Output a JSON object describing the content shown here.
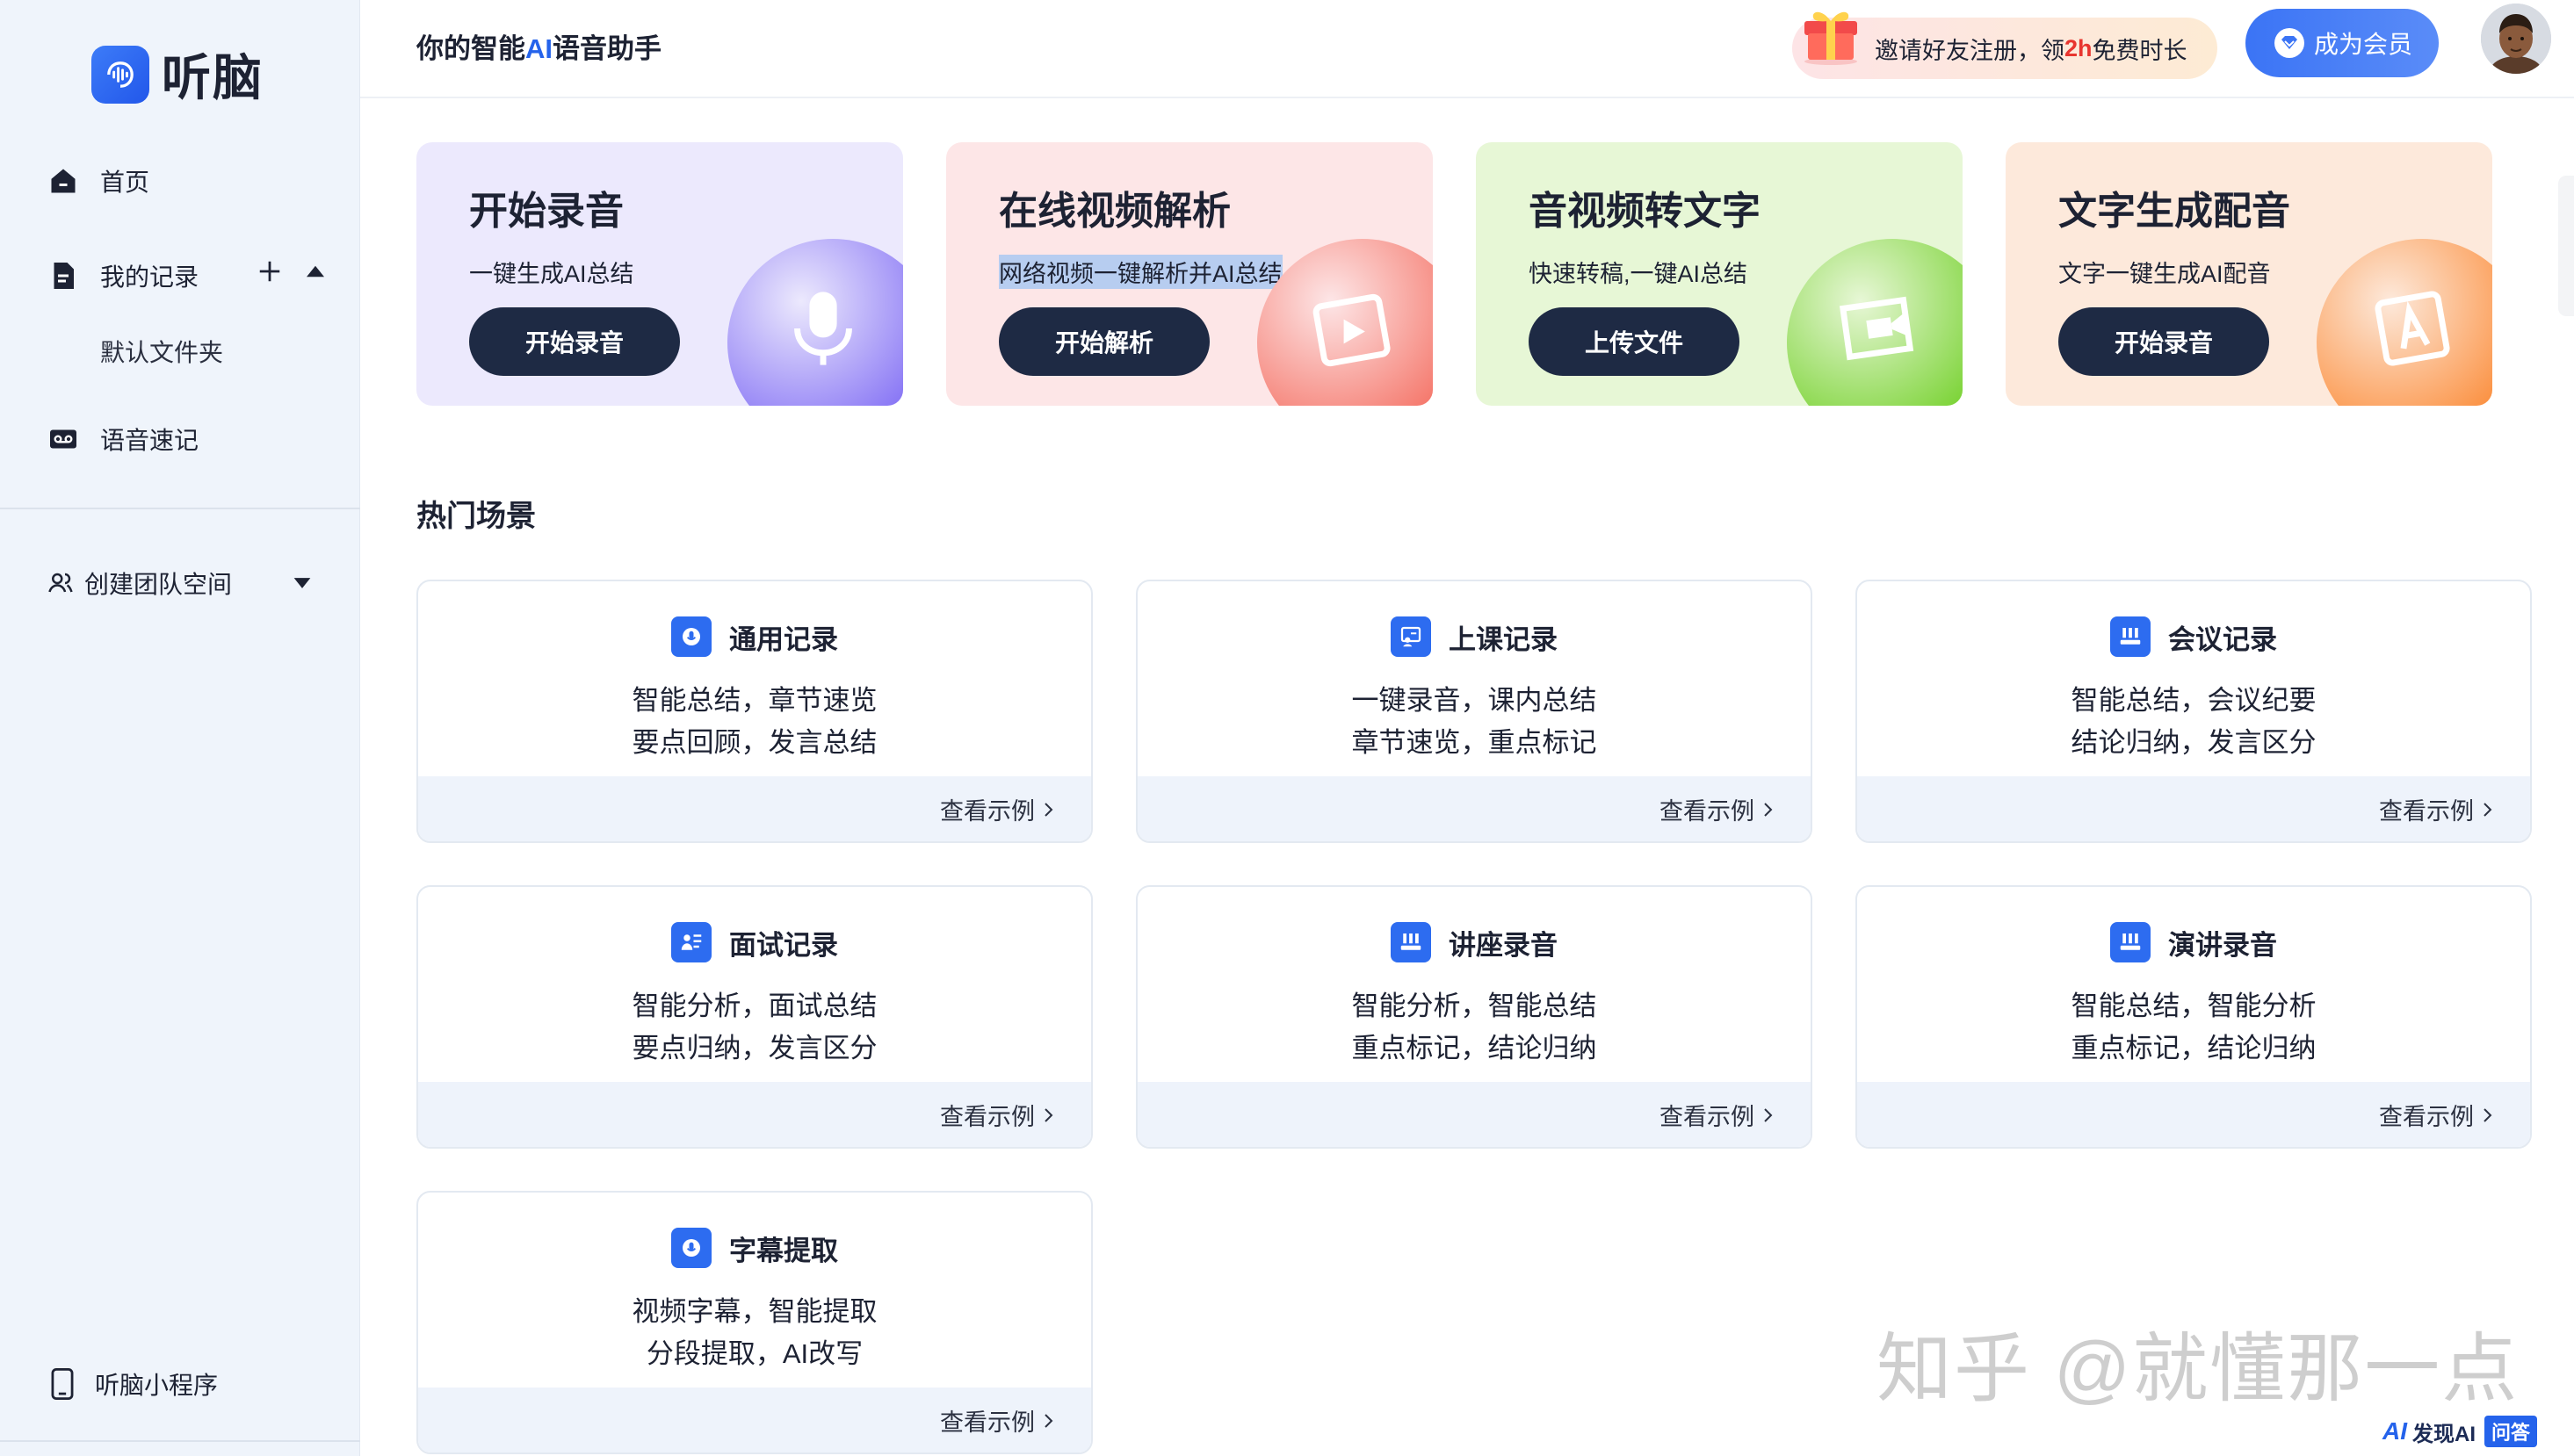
{
  "app": {
    "name": "听脑"
  },
  "sidebar": {
    "home": "首页",
    "records": "我的记录",
    "default_folder": "默认文件夹",
    "voice_memo": "语音速记",
    "team_space": "创建团队空间",
    "mini_program": "听脑小程序"
  },
  "header": {
    "tagline_prefix": "你的智能",
    "tagline_ai": "AI",
    "tagline_suffix": "语音助手",
    "invite_prefix": "邀请好友注册，领",
    "invite_highlight": "2h",
    "invite_suffix": "免费时长",
    "vip_label": "成为会员"
  },
  "features": [
    {
      "title": "开始录音",
      "desc": "一键生成AI总结",
      "button": "开始录音",
      "icon": "microphone-icon",
      "bg": "#ece9fd",
      "accent": "#8a78f5"
    },
    {
      "title": "在线视频解析",
      "desc": "网络视频一键解析并AI总结",
      "button": "开始解析",
      "icon": "video-play-icon",
      "bg": "#fde6e7",
      "accent": "#f57a6e"
    },
    {
      "title": "音视频转文字",
      "desc": "快速转稿,一键AI总结",
      "button": "上传文件",
      "icon": "video-camera-icon",
      "bg": "#e7f7d6",
      "accent": "#7ed43a"
    },
    {
      "title": "文字生成配音",
      "desc": "文字一键生成AI配音",
      "button": "开始录音",
      "icon": "text-a-icon",
      "bg": "#fde9db",
      "accent": "#fb9345"
    }
  ],
  "section": {
    "title": "热门场景"
  },
  "scenes": [
    {
      "title": "通用记录",
      "line1": "智能总结，章节速览",
      "line2": "要点回顾，发言总结",
      "more": "查看示例"
    },
    {
      "title": "上课记录",
      "line1": "一键录音，课内总结",
      "line2": "章节速览，重点标记",
      "more": "查看示例"
    },
    {
      "title": "会议记录",
      "line1": "智能总结，会议纪要",
      "line2": "结论归纳，发言区分",
      "more": "查看示例"
    },
    {
      "title": "面试记录",
      "line1": "智能分析，面试总结",
      "line2": "要点归纳，发言区分",
      "more": "查看示例"
    },
    {
      "title": "讲座录音",
      "line1": "智能分析，智能总结",
      "line2": "重点标记，结论归纳",
      "more": "查看示例"
    },
    {
      "title": "演讲录音",
      "line1": "智能总结，智能分析",
      "line2": "重点标记，结论归纳",
      "more": "查看示例"
    },
    {
      "title": "字幕提取",
      "line1": "视频字幕，智能提取",
      "line2": "分段提取，AI改写",
      "more": "查看示例"
    }
  ],
  "watermark": {
    "text": "知乎 @就懂那一点",
    "brand_ai": "AI",
    "brand_name": "发现AI",
    "brand_tag": "问答"
  }
}
